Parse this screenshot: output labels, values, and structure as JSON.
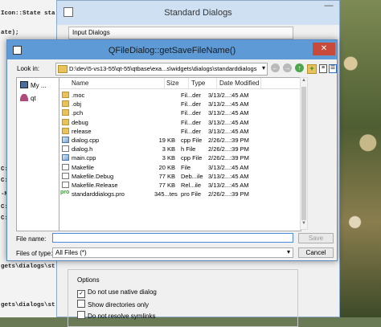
{
  "background_code": {
    "lines": [
      "Icon::State sta",
      "ate);",
      "C:",
      "C:",
      "-M",
      "C:",
      "C:",
      "gets\\dialogs\\st",
      "gets\\dialogs\\st"
    ]
  },
  "standard_dialogs": {
    "title": "Standard Dialogs",
    "min_label": "—",
    "input_group_label": "Input Dialogs",
    "options_label": "Options",
    "options": [
      {
        "label": "Do not use native dialog",
        "checked": true
      },
      {
        "label": "Show directories only",
        "checked": false
      },
      {
        "label": "Do not resolve symlinks",
        "checked": false
      }
    ]
  },
  "file_dialog": {
    "title": "QFileDialog::getSaveFileName()",
    "close_label": "✕",
    "lookin_label": "Look in:",
    "lookin_path": "D:\\dev\\5-vs13-55\\qt-55\\qtbase\\exa...s\\widgets\\dialogs\\standarddialogs",
    "sidebar": [
      {
        "label": "My ...",
        "icon": "computer-icon"
      },
      {
        "label": "qt",
        "icon": "user-icon"
      }
    ],
    "columns": {
      "name": "Name",
      "size": "Size",
      "type": "Type",
      "date": "Date Modified"
    },
    "files": [
      {
        "name": ".moc",
        "size": "",
        "type": "Fil...der",
        "date": "3/13/2...:45 AM",
        "icon": "folder"
      },
      {
        "name": ".obj",
        "size": "",
        "type": "Fil...der",
        "date": "3/13/2...:45 AM",
        "icon": "folder"
      },
      {
        "name": ".pch",
        "size": "",
        "type": "Fil...der",
        "date": "3/13/2...:45 AM",
        "icon": "folder"
      },
      {
        "name": "debug",
        "size": "",
        "type": "Fil...der",
        "date": "3/13/2...:45 AM",
        "icon": "folder"
      },
      {
        "name": "release",
        "size": "",
        "type": "Fil...der",
        "date": "3/13/2...:45 AM",
        "icon": "folder"
      },
      {
        "name": "dialog.cpp",
        "size": "19 KB",
        "type": "cpp File",
        "date": "2/26/2...:39 PM",
        "icon": "cpp"
      },
      {
        "name": "dialog.h",
        "size": "3 KB",
        "type": "h File",
        "date": "2/26/2...:39 PM",
        "icon": "file"
      },
      {
        "name": "main.cpp",
        "size": "3 KB",
        "type": "cpp File",
        "date": "2/26/2...:39 PM",
        "icon": "cpp"
      },
      {
        "name": "Makefile",
        "size": "20 KB",
        "type": "File",
        "date": "3/13/2...:45 AM",
        "icon": "file"
      },
      {
        "name": "Makefile.Debug",
        "size": "77 KB",
        "type": "Deb...ile",
        "date": "3/13/2...:45 AM",
        "icon": "file"
      },
      {
        "name": "Makefile.Release",
        "size": "77 KB",
        "type": "Rel...ile",
        "date": "3/13/2...:45 AM",
        "icon": "file"
      },
      {
        "name": "standarddialogs.pro",
        "size": "345...tes",
        "type": "pro File",
        "date": "2/26/2...:39 PM",
        "icon": "pro"
      }
    ],
    "filename_label": "File name:",
    "filename_value": "",
    "filetype_label": "Files of type:",
    "filetype_value": "All Files (*)",
    "save_label": "Save",
    "cancel_label": "Cancel"
  }
}
